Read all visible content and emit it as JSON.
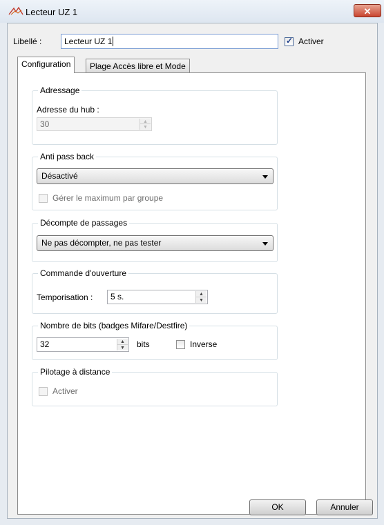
{
  "window": {
    "title": "Lecteur UZ 1"
  },
  "header": {
    "libelle_label": "Libellé :",
    "libelle_value": "Lecteur UZ 1",
    "activer_label": "Activer",
    "activer_checked": true
  },
  "tabs": [
    {
      "label": "Configuration",
      "active": true
    },
    {
      "label": "Plage Accès libre et Mode",
      "active": false
    }
  ],
  "adressage": {
    "legend": "Adressage",
    "hub_label": "Adresse du hub :",
    "hub_value": "30"
  },
  "anti_pass_back": {
    "legend": "Anti pass back",
    "selected": "Désactivé",
    "max_group_label": "Gérer le maximum par groupe"
  },
  "decompte": {
    "legend": "Décompte de passages",
    "selected": "Ne pas décompter, ne pas tester"
  },
  "commande": {
    "legend": "Commande d'ouverture",
    "tempo_label": "Temporisation :",
    "tempo_value": "5 s."
  },
  "bits": {
    "legend": "Nombre de bits (badges Mifare/Destfire)",
    "value": "32",
    "unit": "bits",
    "inverse_label": "Inverse"
  },
  "pilotage": {
    "legend": "Pilotage à distance",
    "activer_label": "Activer"
  },
  "footer": {
    "ok_label": "OK",
    "cancel_label": "Annuler"
  },
  "icons": {
    "app": "reader-app-icon",
    "close": "close-icon"
  },
  "colors": {
    "close_button": "#c9452f",
    "window_frame": "#e6ebf1",
    "focus_border": "#7a9cd3"
  }
}
